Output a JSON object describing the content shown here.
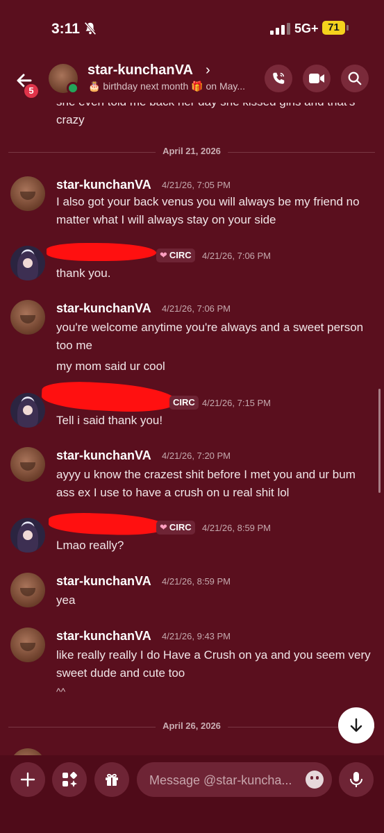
{
  "status_bar": {
    "time": "3:11",
    "network": "5G+",
    "battery": "71"
  },
  "header": {
    "unread_count": "5",
    "name": "star-kunchanVA",
    "subtitle": "🎂 birthday next month 🎁 on May..."
  },
  "chat": {
    "clipped_text": "she even told me back her day she kissed girls and that's crazy",
    "dividers": [
      {
        "date": "April 21, 2026"
      },
      {
        "date": "April 26, 2026"
      }
    ],
    "messages": [
      {
        "author": "star-kunchanVA",
        "time": "4/21/26, 7:05 PM",
        "lines": [
          "I also got your back venus you will always be my friend no matter what I will always stay on your side"
        ]
      },
      {
        "author_tag": "CIRC",
        "time": "4/21/26, 7:06 PM",
        "lines": [
          "thank you."
        ]
      },
      {
        "author": "star-kunchanVA",
        "time": "4/21/26, 7:06 PM",
        "lines": [
          "you're welcome anytime you're always and a sweet person too me",
          "my mom said ur cool"
        ]
      },
      {
        "author_tag": "CIRC",
        "time": "4/21/26, 7:15 PM",
        "lines": [
          "Tell i said thank you!"
        ]
      },
      {
        "author": "star-kunchanVA",
        "time": "4/21/26, 7:20 PM",
        "lines": [
          "ayyy u know the crazest shit before I met you and ur bum ass ex I use to have a crush on u real  shit lol"
        ]
      },
      {
        "author_tag": "CIRC",
        "time": "4/21/26, 8:59 PM",
        "lines": [
          "Lmao really?"
        ]
      },
      {
        "author": "star-kunchanVA",
        "time": "4/21/26, 8:59 PM",
        "lines": [
          "yea"
        ]
      },
      {
        "author": "star-kunchanVA",
        "time": "4/21/26, 9:43 PM",
        "lines": [
          "like really really I do Have a Crush on ya and you seem very sweet dude and cute too",
          "^^"
        ]
      }
    ]
  },
  "composer": {
    "placeholder": "Message @star-kuncha..."
  }
}
